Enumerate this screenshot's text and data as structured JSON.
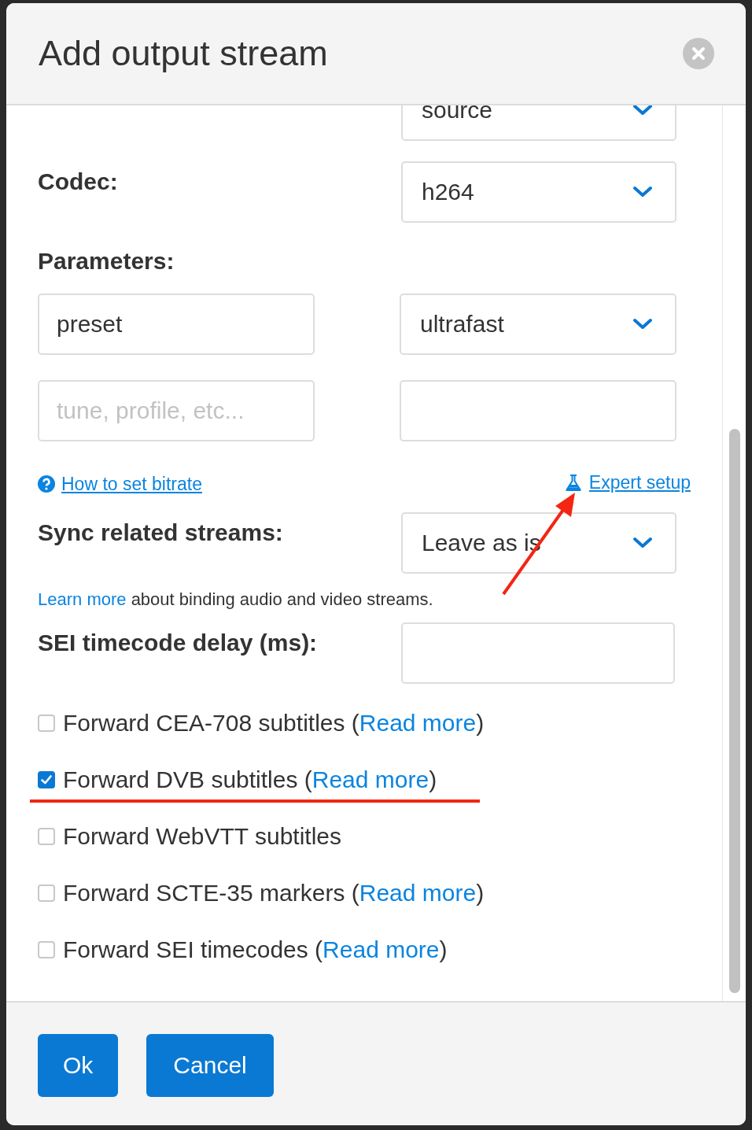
{
  "dialog": {
    "title": "Add output stream"
  },
  "top_select": {
    "value": "source"
  },
  "codec": {
    "label": "Codec:",
    "value": "h264"
  },
  "parameters": {
    "label": "Parameters:",
    "rows": [
      {
        "name": {
          "value": "preset"
        },
        "value": {
          "kind": "select",
          "value": "ultrafast"
        }
      },
      {
        "name": {
          "placeholder": "tune, profile, etc..."
        },
        "value": {
          "kind": "input"
        }
      }
    ]
  },
  "links": {
    "bitrate_help": "How to set bitrate",
    "expert_setup": "Expert setup"
  },
  "sync": {
    "label": "Sync related streams:",
    "value": "Leave as is",
    "note_link": "Learn more",
    "note_text": " about binding audio and video streams."
  },
  "sei_delay": {
    "label": "SEI timecode delay (ms):"
  },
  "checkboxes": [
    {
      "text": "Forward CEA-708 subtitles (",
      "link": "Read more",
      "after": ")",
      "checked": false
    },
    {
      "text": "Forward DVB subtitles (",
      "link": "Read more",
      "after": ")",
      "checked": true
    },
    {
      "text": "Forward WebVTT subtitles",
      "checked": false
    },
    {
      "text": "Forward SCTE-35 markers (",
      "link": "Read more",
      "after": ")",
      "checked": false
    },
    {
      "text": "Forward SEI timecodes (",
      "link": "Read more",
      "after": ")",
      "checked": false
    }
  ],
  "buttons": [
    "Ok",
    "Cancel"
  ]
}
